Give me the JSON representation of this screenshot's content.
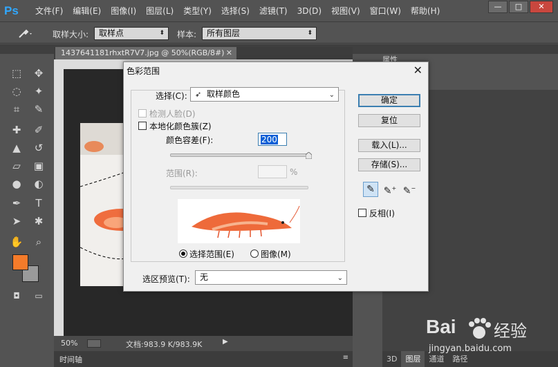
{
  "app": {
    "logo": "Ps",
    "accent": "#31a8ff"
  },
  "menu": [
    "文件(F)",
    "编辑(E)",
    "图像(I)",
    "图层(L)",
    "类型(Y)",
    "选择(S)",
    "滤镜(T)",
    "3D(D)",
    "视图(V)",
    "窗口(W)",
    "帮助(H)"
  ],
  "window_controls": {
    "minimize": "—",
    "maximize": "□",
    "close": "✕"
  },
  "options": {
    "tool_icon": "eyedropper-icon",
    "sample_size_label": "取样大小:",
    "sample_size_value": "取样点",
    "sample_label": "样本:",
    "sample_value": "所有图层"
  },
  "document": {
    "tab_title": "1437641181rhxtR7V7.jpg @ 50%(RGB/8#)",
    "tab_close": "✕",
    "zoom": "50%",
    "doc_info": "文档:983.9 K/983.9K",
    "timeline_label": "时间轴"
  },
  "panels": {
    "properties_label": "属性",
    "bottom_tabs": [
      "3D",
      "图层",
      "通道",
      "路径"
    ],
    "active_bottom_tab": 1
  },
  "dialog": {
    "title": "色彩范围",
    "close": "✕",
    "select_label": "选择(C):",
    "select_value": "取样颜色",
    "detect_faces": {
      "label": "检测人脸(D)",
      "checked": false,
      "enabled": false
    },
    "localized_clusters": {
      "label": "本地化颜色簇(Z)",
      "checked": false
    },
    "fuzziness_label": "颜色容差(F):",
    "fuzziness_value": "200",
    "fuzziness_fraction": 1.0,
    "range_label": "范围(R):",
    "range_unit": "%",
    "preview_mode_selection": "选择范围(E)",
    "preview_mode_image": "图像(M)",
    "selected_preview_mode": "selection",
    "selection_preview_label": "选区预览(T):",
    "selection_preview_value": "无",
    "buttons": {
      "ok": "确定",
      "reset": "复位",
      "load": "载入(L)...",
      "save": "存储(S)..."
    },
    "invert_label": "反相(I)"
  },
  "colors": {
    "foreground": "#f47b2a",
    "background": "#9a9a9a",
    "dialog_default_border": "#3c7fb1",
    "fuzziness_highlight": "#0a5fd6"
  },
  "watermark": {
    "brand": "Bai",
    "brand_suffix": "经验",
    "url": "jingyan.baidu.com"
  }
}
